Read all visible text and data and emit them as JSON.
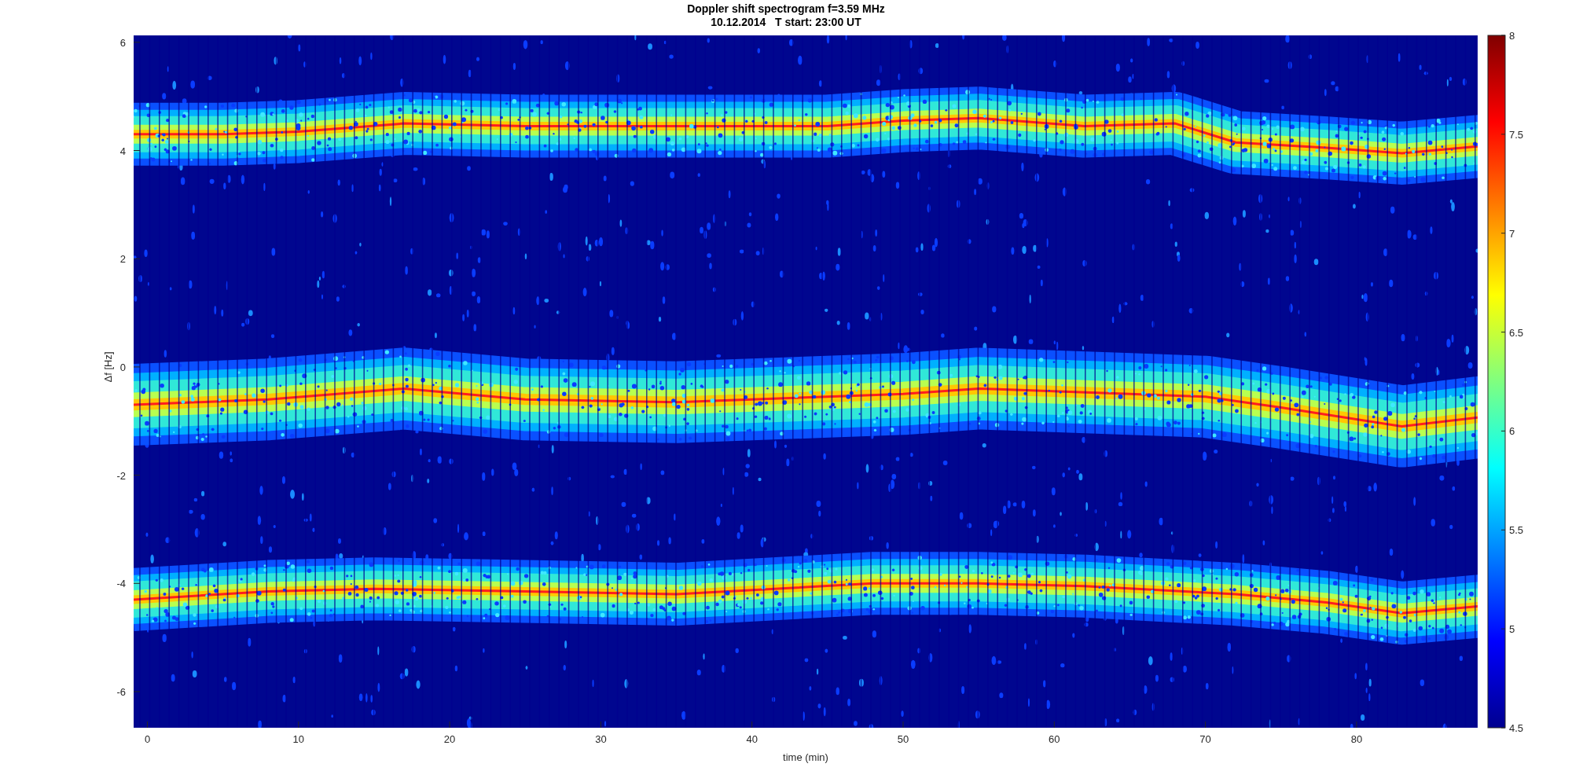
{
  "figure": {
    "title": "Doppler shift spectrogram f=3.59 MHz",
    "subtitle": "10.12.2014   T start: 23:00 UT",
    "xlabel": "time (min)",
    "ylabel": "Δf [Hz]",
    "xticks": [
      "0",
      "10",
      "20",
      "30",
      "40",
      "50",
      "60",
      "70",
      "80"
    ],
    "yticks": [
      "6",
      "4",
      "2",
      "0",
      "-2",
      "-4",
      "-6"
    ],
    "colorbar": {
      "ticks": [
        "8",
        "7.5",
        "7",
        "6.5",
        "6",
        "5.5",
        "5",
        "4.5"
      ]
    }
  }
}
